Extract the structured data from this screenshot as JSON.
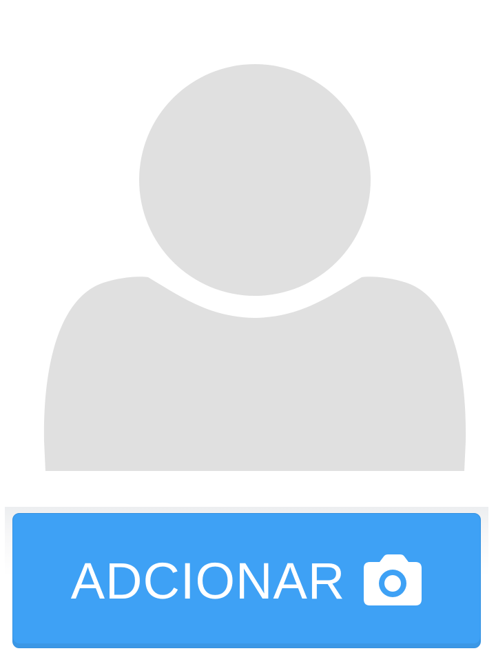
{
  "avatar": {
    "icon": "user-placeholder-icon",
    "color": "#e0e0e0"
  },
  "add_button": {
    "label": "ADCIONAR",
    "icon": "camera-icon",
    "background": "#3ea1f5",
    "text_color": "#ffffff"
  }
}
